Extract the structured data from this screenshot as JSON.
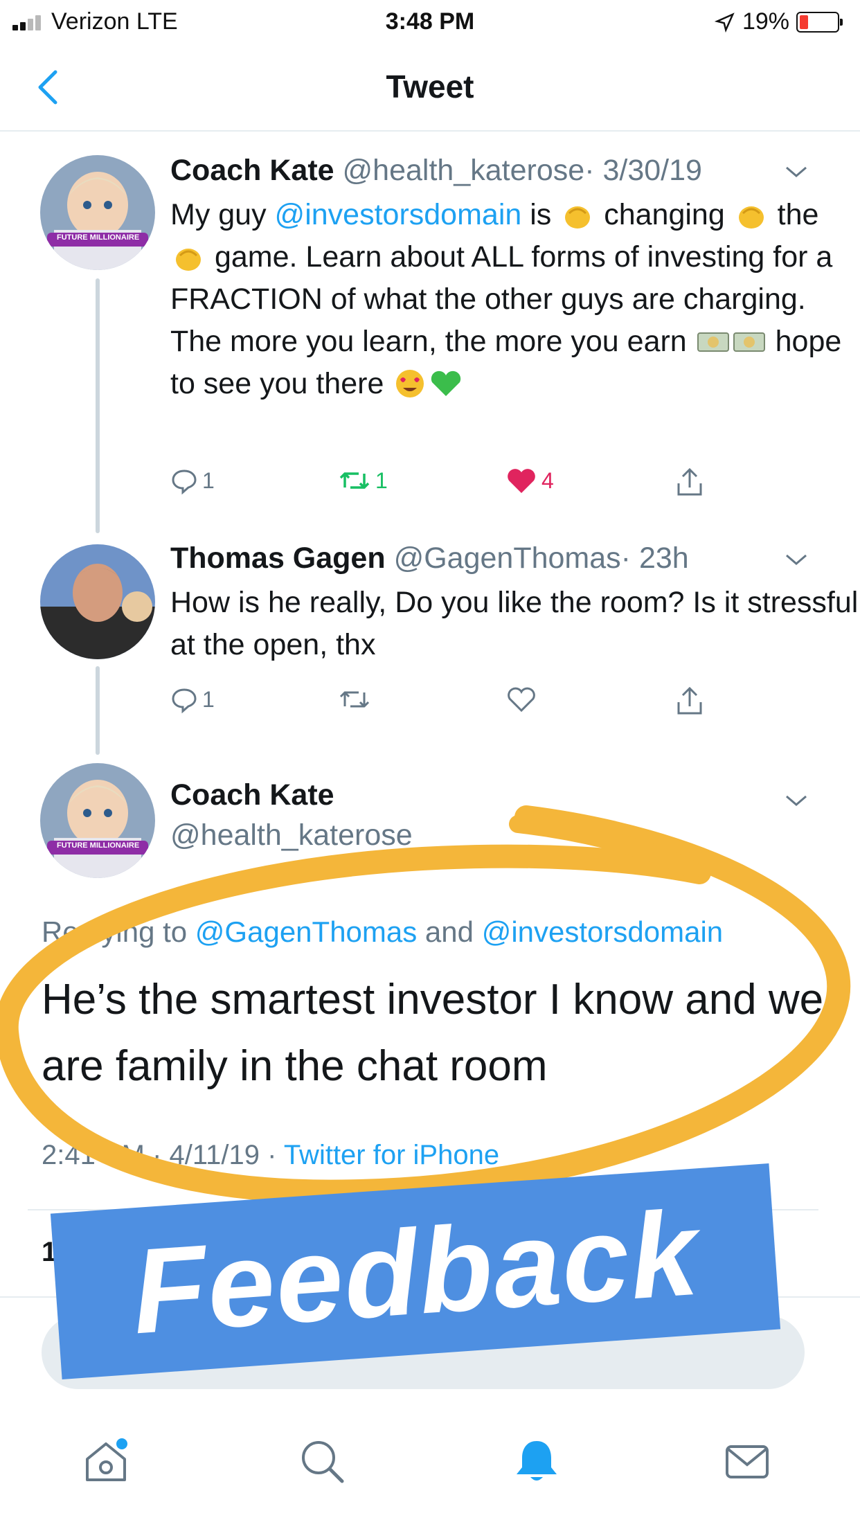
{
  "status_bar": {
    "carrier": "Verizon  LTE",
    "time": "3:48 PM",
    "battery": "19%"
  },
  "nav": {
    "title": "Tweet"
  },
  "tweet1": {
    "name": "Coach Kate",
    "handle": "@health_katerose",
    "date": "· 3/30/19",
    "avatar_badge": "FUTURE MILLIONAIRE",
    "t1": "My guy ",
    "mention": "@investorsdomain",
    "t2": " is ",
    "t3": " changing ",
    "t4": " the ",
    "t5": " game. Learn about ALL forms of investing for a FRACTION of what the other guys are charging. The more you learn, the more you earn ",
    "t6": " hope to see you there ",
    "replies": "1",
    "retweets": "1",
    "likes": "4"
  },
  "tweet2": {
    "name": "Thomas Gagen",
    "handle": "@GagenThomas",
    "date": "· 23h",
    "text": "How is he really, Do you like the room? Is it stressful at the open, thx",
    "replies": "1"
  },
  "focus": {
    "name": "Coach Kate",
    "handle": "@health_katerose",
    "avatar_badge": "FUTURE MILLIONAIRE",
    "reply_prefix": "Replying to ",
    "mention1": "@GagenThomas",
    "and": " and ",
    "mention2": "@investorsdomain",
    "text": "He’s the smartest investor I know and we are family in the chat room",
    "time": "2:41 PM · 4/11/19 · ",
    "source": "Twitter for iPhone",
    "like_count": "1"
  },
  "overlay": {
    "label": "Feedback",
    "circle_color": "#f4b63a",
    "label_bg": "#4e8fe1"
  },
  "colors": {
    "link": "#1da1f2",
    "muted": "#657786",
    "like": "#e0245e",
    "retweet": "#17bf63"
  },
  "icons": [
    "back-chevron-icon",
    "reply-icon",
    "retweet-icon",
    "like-icon",
    "share-icon",
    "home-icon",
    "search-icon",
    "notifications-icon",
    "messages-icon"
  ]
}
